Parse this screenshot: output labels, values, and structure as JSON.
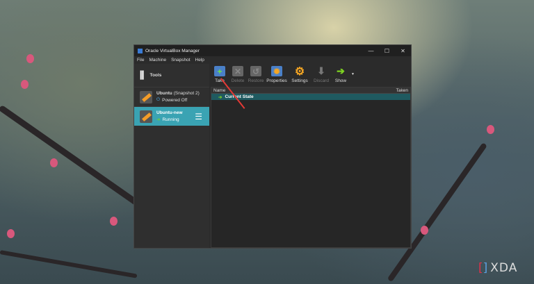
{
  "window": {
    "title": "Oracle VirtualBox Manager",
    "controls": [
      "—",
      "☐",
      "✕"
    ]
  },
  "menu": [
    "File",
    "Machine",
    "Snapshot",
    "Help"
  ],
  "tools_label": "Tools",
  "vms": [
    {
      "name": "Ubuntu",
      "snapshot": "(Snapshot 2)",
      "state": "Powered Off"
    },
    {
      "name": "Ubuntu-new",
      "snapshot": "",
      "state": "Running"
    }
  ],
  "toolbar": [
    {
      "label": "Take",
      "enabled": true
    },
    {
      "label": "Delete",
      "enabled": false
    },
    {
      "label": "Restore",
      "enabled": false
    },
    {
      "label": "Properties",
      "enabled": true
    },
    {
      "label": "Settings",
      "enabled": true
    },
    {
      "label": "Discard",
      "enabled": false
    },
    {
      "label": "Show",
      "enabled": true
    }
  ],
  "table": {
    "columns": [
      "Name",
      "Taken"
    ],
    "rows": [
      {
        "name": "Current State"
      }
    ]
  },
  "watermark": "XDA"
}
